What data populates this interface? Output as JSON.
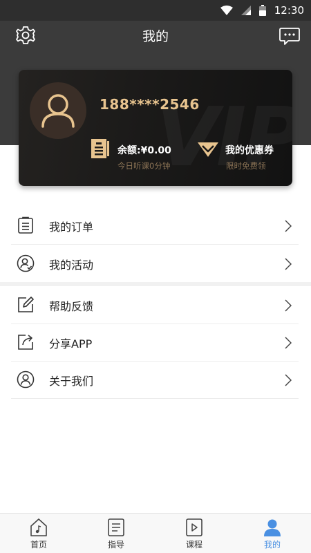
{
  "status_bar": {
    "time": "12:30"
  },
  "header": {
    "title": "我的"
  },
  "card": {
    "phone": "188****2546",
    "balance": "余额:¥0.00",
    "listen_time": "今日听课0分钟",
    "coupon": "我的优惠券",
    "coupon_sub": "限时免费领",
    "watermark": "VIP"
  },
  "menu": {
    "orders": "我的订单",
    "activities": "我的活动",
    "feedback": "帮助反馈",
    "share": "分享APP",
    "about": "关于我们"
  },
  "tabs": [
    {
      "label": "首页",
      "icon": "home-music-icon"
    },
    {
      "label": "指导",
      "icon": "document-icon"
    },
    {
      "label": "课程",
      "icon": "play-icon"
    },
    {
      "label": "我的",
      "icon": "user-icon"
    }
  ],
  "active_tab": "我的",
  "colors": {
    "accent": "#4a90e2",
    "gold": "#e8c48f",
    "header": "#3b3b3b"
  }
}
